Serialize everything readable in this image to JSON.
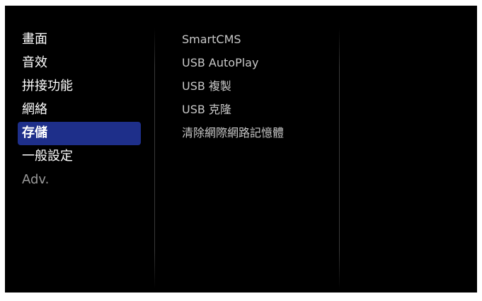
{
  "main_menu": {
    "items": [
      {
        "label": "畫面",
        "enabled": true,
        "selected": false
      },
      {
        "label": "音效",
        "enabled": true,
        "selected": false
      },
      {
        "label": "拼接功能",
        "enabled": true,
        "selected": false
      },
      {
        "label": "網絡",
        "enabled": true,
        "selected": false
      },
      {
        "label": "存儲",
        "enabled": true,
        "selected": true
      },
      {
        "label": "一般設定",
        "enabled": true,
        "selected": false
      },
      {
        "label": "Adv.",
        "enabled": false,
        "selected": false
      }
    ]
  },
  "submenu": {
    "items": [
      {
        "label": "SmartCMS"
      },
      {
        "label": "USB AutoPlay"
      },
      {
        "label": "USB 複製"
      },
      {
        "label": "USB 克隆"
      },
      {
        "label": "清除網際網路記憶體"
      }
    ]
  },
  "colors": {
    "background": "#000000",
    "selection": "#1e2f8a",
    "text_primary": "#ffffff",
    "text_secondary": "#c8c8c8",
    "text_disabled": "#9a9a9a"
  }
}
